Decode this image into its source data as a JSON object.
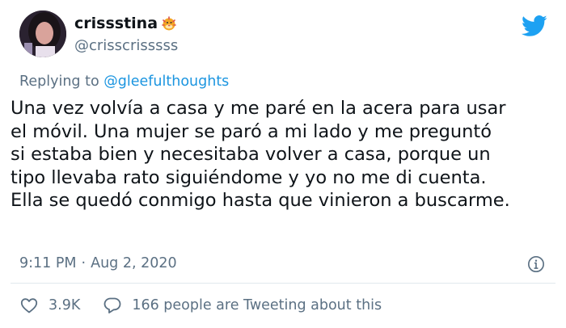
{
  "author": {
    "display_name": "crissstina",
    "handle": "@crisscrisssss"
  },
  "reply": {
    "prefix": "Replying to",
    "mention": "@gleefulthoughts"
  },
  "tweet": {
    "text": "Una vez volvía a casa y me paré en la acera para usar\nel móvil. Una mujer se paró a mi lado y me preguntó\nsi estaba bien y necesitaba volver a casa, porque un\ntipo llevaba rato siguiéndome y yo no me di cuenta.\nElla se quedó conmigo hasta que vinieron a buscarme.",
    "time": "9:11 PM",
    "separator": "·",
    "date": "Aug 2, 2020"
  },
  "actions": {
    "likes": "3.9K",
    "conversation": "166 people are Tweeting about this"
  },
  "icons": {
    "brand": "twitter-bird-icon",
    "name_emoji": "blowfish-emoji-icon",
    "info": "info-icon",
    "like": "heart-icon",
    "reply": "speech-bubble-icon"
  },
  "colors": {
    "brand_blue": "#1da1f2",
    "mention_blue": "#1b95e0",
    "secondary_text": "#5b7083",
    "primary_text": "#0f1419",
    "divider": "#e1e8ed"
  }
}
